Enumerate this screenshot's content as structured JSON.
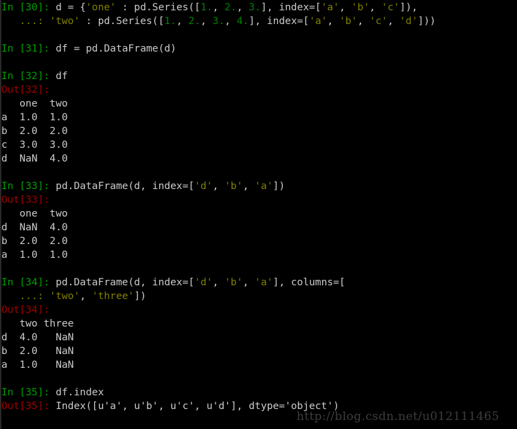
{
  "terminal": {
    "app": "ipython-console",
    "background_color": "#000000",
    "foreground_color": "#cccccc",
    "colors": {
      "prompt_in": "#00a000",
      "prompt_out": "#a00000",
      "continuation": "#808000",
      "string": "#808000",
      "number": "#008000",
      "plain": "#cccccc",
      "watermark": "#3d3d3d"
    },
    "watermark": "http://blog.csdn.net/u012111465",
    "lines": [
      {
        "name": "in-30-line-1",
        "spans": [
          {
            "cls": "c-prompt-in",
            "t": "In [30]:"
          },
          {
            "cls": "c-text",
            "t": " d = {"
          },
          {
            "cls": "c-str",
            "t": "'one'"
          },
          {
            "cls": "c-text",
            "t": " : pd.Series(["
          },
          {
            "cls": "c-num",
            "t": "1."
          },
          {
            "cls": "c-text",
            "t": ", "
          },
          {
            "cls": "c-num",
            "t": "2."
          },
          {
            "cls": "c-text",
            "t": ", "
          },
          {
            "cls": "c-num",
            "t": "3."
          },
          {
            "cls": "c-text",
            "t": "], index=["
          },
          {
            "cls": "c-str",
            "t": "'a'"
          },
          {
            "cls": "c-text",
            "t": ", "
          },
          {
            "cls": "c-str",
            "t": "'b'"
          },
          {
            "cls": "c-text",
            "t": ", "
          },
          {
            "cls": "c-str",
            "t": "'c'"
          },
          {
            "cls": "c-text",
            "t": "]),"
          }
        ]
      },
      {
        "name": "in-30-line-2-continuation",
        "spans": [
          {
            "cls": "c-cont",
            "t": "   ...:"
          },
          {
            "cls": "c-text",
            "t": " "
          },
          {
            "cls": "c-str",
            "t": "'two'"
          },
          {
            "cls": "c-text",
            "t": " : pd.Series(["
          },
          {
            "cls": "c-num",
            "t": "1."
          },
          {
            "cls": "c-text",
            "t": ", "
          },
          {
            "cls": "c-num",
            "t": "2."
          },
          {
            "cls": "c-text",
            "t": ", "
          },
          {
            "cls": "c-num",
            "t": "3."
          },
          {
            "cls": "c-text",
            "t": ", "
          },
          {
            "cls": "c-num",
            "t": "4."
          },
          {
            "cls": "c-text",
            "t": "], index=["
          },
          {
            "cls": "c-str",
            "t": "'a'"
          },
          {
            "cls": "c-text",
            "t": ", "
          },
          {
            "cls": "c-str",
            "t": "'b'"
          },
          {
            "cls": "c-text",
            "t": ", "
          },
          {
            "cls": "c-str",
            "t": "'c'"
          },
          {
            "cls": "c-text",
            "t": ", "
          },
          {
            "cls": "c-str",
            "t": "'d'"
          },
          {
            "cls": "c-text",
            "t": "]))"
          }
        ]
      },
      {
        "name": "blank-line",
        "spans": [
          {
            "cls": "c-text",
            "t": ""
          }
        ]
      },
      {
        "name": "in-31-line",
        "spans": [
          {
            "cls": "c-prompt-in",
            "t": "In [31]:"
          },
          {
            "cls": "c-text",
            "t": " df = pd.DataFrame(d)"
          }
        ]
      },
      {
        "name": "blank-line",
        "spans": [
          {
            "cls": "c-text",
            "t": ""
          }
        ]
      },
      {
        "name": "in-32-line",
        "spans": [
          {
            "cls": "c-prompt-in",
            "t": "In [32]:"
          },
          {
            "cls": "c-text",
            "t": " df"
          }
        ]
      },
      {
        "name": "out-32-label",
        "spans": [
          {
            "cls": "c-prompt-out",
            "t": "Out[32]:"
          }
        ]
      },
      {
        "name": "out-32-header",
        "spans": [
          {
            "cls": "c-text",
            "t": "   one  two"
          }
        ]
      },
      {
        "name": "out-32-row-a",
        "spans": [
          {
            "cls": "c-text",
            "t": "a  1.0  1.0"
          }
        ]
      },
      {
        "name": "out-32-row-b",
        "spans": [
          {
            "cls": "c-text",
            "t": "b  2.0  2.0"
          }
        ]
      },
      {
        "name": "out-32-row-c",
        "spans": [
          {
            "cls": "c-text",
            "t": "c  3.0  3.0"
          }
        ]
      },
      {
        "name": "out-32-row-d",
        "spans": [
          {
            "cls": "c-text",
            "t": "d  NaN  4.0"
          }
        ]
      },
      {
        "name": "blank-line",
        "spans": [
          {
            "cls": "c-text",
            "t": ""
          }
        ]
      },
      {
        "name": "in-33-line",
        "spans": [
          {
            "cls": "c-prompt-in",
            "t": "In [33]:"
          },
          {
            "cls": "c-text",
            "t": " pd.DataFrame(d, index=["
          },
          {
            "cls": "c-str",
            "t": "'d'"
          },
          {
            "cls": "c-text",
            "t": ", "
          },
          {
            "cls": "c-str",
            "t": "'b'"
          },
          {
            "cls": "c-text",
            "t": ", "
          },
          {
            "cls": "c-str",
            "t": "'a'"
          },
          {
            "cls": "c-text",
            "t": "])"
          }
        ]
      },
      {
        "name": "out-33-label",
        "spans": [
          {
            "cls": "c-prompt-out",
            "t": "Out[33]:"
          }
        ]
      },
      {
        "name": "out-33-header",
        "spans": [
          {
            "cls": "c-text",
            "t": "   one  two"
          }
        ]
      },
      {
        "name": "out-33-row-d",
        "spans": [
          {
            "cls": "c-text",
            "t": "d  NaN  4.0"
          }
        ]
      },
      {
        "name": "out-33-row-b",
        "spans": [
          {
            "cls": "c-text",
            "t": "b  2.0  2.0"
          }
        ]
      },
      {
        "name": "out-33-row-a",
        "spans": [
          {
            "cls": "c-text",
            "t": "a  1.0  1.0"
          }
        ]
      },
      {
        "name": "blank-line",
        "spans": [
          {
            "cls": "c-text",
            "t": ""
          }
        ]
      },
      {
        "name": "in-34-line-1",
        "spans": [
          {
            "cls": "c-prompt-in",
            "t": "In [34]:"
          },
          {
            "cls": "c-text",
            "t": " pd.DataFrame(d, index=["
          },
          {
            "cls": "c-str",
            "t": "'d'"
          },
          {
            "cls": "c-text",
            "t": ", "
          },
          {
            "cls": "c-str",
            "t": "'b'"
          },
          {
            "cls": "c-text",
            "t": ", "
          },
          {
            "cls": "c-str",
            "t": "'a'"
          },
          {
            "cls": "c-text",
            "t": "], columns=["
          }
        ]
      },
      {
        "name": "in-34-line-2-continuation",
        "spans": [
          {
            "cls": "c-cont",
            "t": "   ...:"
          },
          {
            "cls": "c-text",
            "t": " "
          },
          {
            "cls": "c-str",
            "t": "'two'"
          },
          {
            "cls": "c-text",
            "t": ", "
          },
          {
            "cls": "c-str",
            "t": "'three'"
          },
          {
            "cls": "c-text",
            "t": "])"
          }
        ]
      },
      {
        "name": "out-34-label",
        "spans": [
          {
            "cls": "c-prompt-out",
            "t": "Out[34]:"
          }
        ]
      },
      {
        "name": "out-34-header",
        "spans": [
          {
            "cls": "c-text",
            "t": "   two three"
          }
        ]
      },
      {
        "name": "out-34-row-d",
        "spans": [
          {
            "cls": "c-text",
            "t": "d  4.0   NaN"
          }
        ]
      },
      {
        "name": "out-34-row-b",
        "spans": [
          {
            "cls": "c-text",
            "t": "b  2.0   NaN"
          }
        ]
      },
      {
        "name": "out-34-row-a",
        "spans": [
          {
            "cls": "c-text",
            "t": "a  1.0   NaN"
          }
        ]
      },
      {
        "name": "blank-line",
        "spans": [
          {
            "cls": "c-text",
            "t": ""
          }
        ]
      },
      {
        "name": "in-35-line",
        "spans": [
          {
            "cls": "c-prompt-in",
            "t": "In [35]:"
          },
          {
            "cls": "c-text",
            "t": " df.index"
          }
        ]
      },
      {
        "name": "out-35-line",
        "spans": [
          {
            "cls": "c-prompt-out",
            "t": "Out[35]:"
          },
          {
            "cls": "c-text",
            "t": " Index([u'a', u'b', u'c', u'd'], dtype='object')"
          }
        ]
      }
    ]
  }
}
